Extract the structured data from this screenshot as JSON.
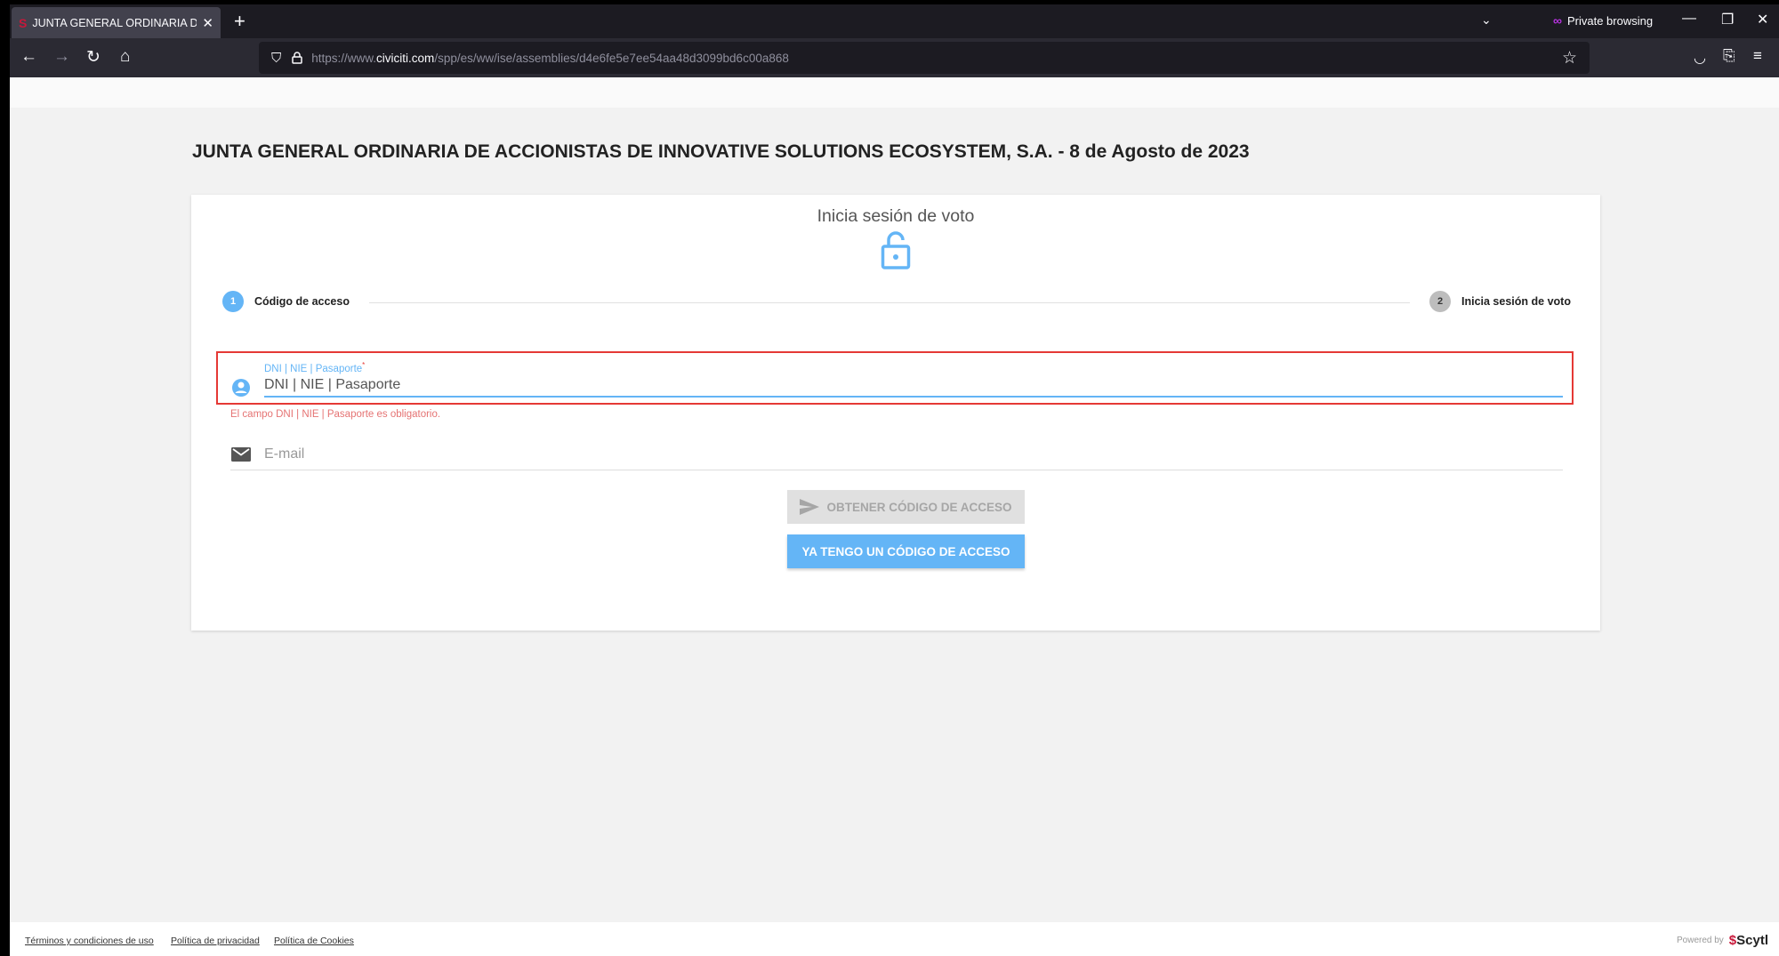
{
  "browser": {
    "tab_title": "JUNTA GENERAL ORDINARIA DE",
    "tab_close": "✕",
    "new_tab": "+",
    "private_label": "Private browsing",
    "url_prefix": "https://www.",
    "url_domain": "civiciti.com",
    "url_path": "/spp/es/ww/ise/assemblies/d4e6fe5e7ee54aa48d3099bd6c00a868"
  },
  "page": {
    "heading": "JUNTA GENERAL ORDINARIA DE ACCIONISTAS DE INNOVATIVE SOLUTIONS ECOSYSTEM, S.A. - 8 de Agosto de 2023",
    "card_title": "Inicia sesión de voto",
    "steps": [
      {
        "num": "1",
        "label": "Código de acceso"
      },
      {
        "num": "2",
        "label": "Inicia sesión de voto"
      }
    ],
    "dni": {
      "float_label": "DNI | NIE | Pasaporte",
      "required_mark": "*",
      "placeholder": "DNI | NIE | Pasaporte",
      "error": "El campo DNI | NIE | Pasaporte es obligatorio."
    },
    "email": {
      "placeholder": "E-mail"
    },
    "buttons": {
      "get_code": "OBTENER CÓDIGO DE ACCESO",
      "have_code": "YA TENGO UN CÓDIGO DE ACCESO"
    }
  },
  "footer": {
    "terms": "Términos y condiciones de uso",
    "privacy": "Política de privacidad",
    "cookies": "Política de Cookies",
    "powered_by": "Powered by",
    "brand": "Scytl"
  },
  "colors": {
    "accent": "#64b5f6",
    "error": "#e53935",
    "brand": "#c8183a"
  }
}
